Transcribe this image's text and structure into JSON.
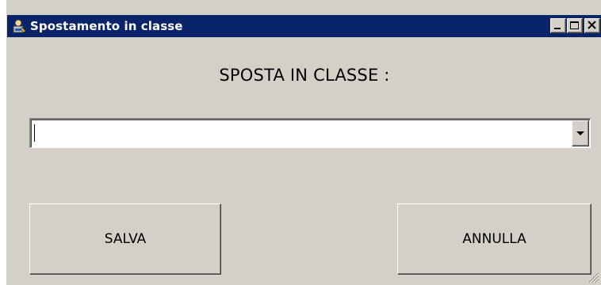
{
  "window": {
    "title": "Spostamento in classe",
    "app_icon": "app-icon",
    "controls": [
      "minimize-icon",
      "maximize-icon",
      "close-icon"
    ]
  },
  "form": {
    "heading": "SPOSTA IN CLASSE :",
    "class_select": {
      "value": "",
      "arrow_icon": "chevron-down-icon"
    }
  },
  "buttons": {
    "save_label": "SALVA",
    "cancel_label": "ANNULLA"
  },
  "colors": {
    "titlebar": "#0a246a",
    "window_face": "#d4d0c8"
  }
}
